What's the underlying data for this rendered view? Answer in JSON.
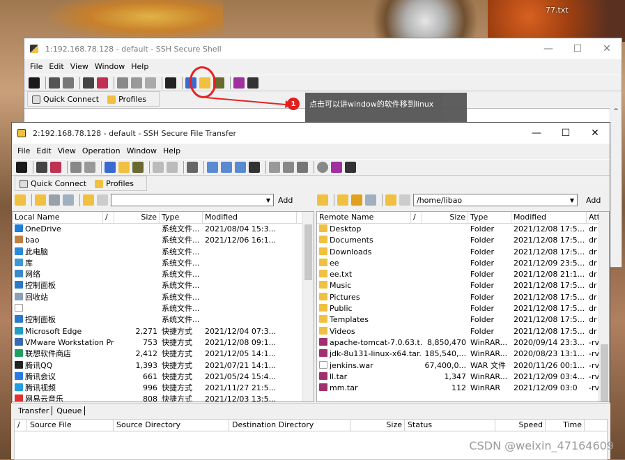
{
  "wallpaper": {
    "file_label": "77.txt"
  },
  "shell_window": {
    "title": "1:192.168.78.128 - default - SSH Secure Shell",
    "menu": [
      "File",
      "Edit",
      "View",
      "Window",
      "Help"
    ],
    "quick_connect": "Quick Connect",
    "profiles": "Profiles"
  },
  "annotation": {
    "badge": "1",
    "text": "点击可以讲window的软件移到linux",
    "color": "#e82020"
  },
  "sftp_window": {
    "title": "2:192.168.78.128 - default - SSH Secure File Transfer",
    "menu": [
      "File",
      "Edit",
      "View",
      "Operation",
      "Window",
      "Help"
    ],
    "quick_connect": "Quick Connect",
    "profiles": "Profiles",
    "local_path": "",
    "remote_path": "/home/libao",
    "add_label": "Add"
  },
  "local": {
    "columns": [
      "Local Name",
      "/",
      "Size",
      "Type",
      "Modified"
    ],
    "rows": [
      {
        "name": "OneDrive",
        "size": "",
        "type": "系统文件...",
        "modified": "2021/08/04 15:3...",
        "icon": "cloud",
        "color": "#1e7fd8"
      },
      {
        "name": "bao",
        "size": "",
        "type": "系统文件...",
        "modified": "2021/12/06 16:1...",
        "icon": "user",
        "color": "#c08040"
      },
      {
        "name": "此电脑",
        "size": "",
        "type": "系统文件...",
        "modified": "",
        "icon": "pc",
        "color": "#2a8ad8"
      },
      {
        "name": "库",
        "size": "",
        "type": "系统文件...",
        "modified": "",
        "icon": "library",
        "color": "#3a9ad8"
      },
      {
        "name": "网络",
        "size": "",
        "type": "系统文件...",
        "modified": "",
        "icon": "network",
        "color": "#3a8ac8"
      },
      {
        "name": "控制面板",
        "size": "",
        "type": "系统文件...",
        "modified": "",
        "icon": "control-panel",
        "color": "#2a7ac8"
      },
      {
        "name": "回收站",
        "size": "",
        "type": "系统文件...",
        "modified": "",
        "icon": "recycle-bin",
        "color": "#8aa0b8"
      },
      {
        "name": "",
        "size": "",
        "type": "系统文件...",
        "modified": "",
        "icon": "blank",
        "color": "#ffffff"
      },
      {
        "name": "控制面板",
        "size": "",
        "type": "系统文件...",
        "modified": "",
        "icon": "control-panel",
        "color": "#2a7ac8"
      },
      {
        "name": "Microsoft Edge",
        "size": "2,271",
        "type": "快捷方式",
        "modified": "2021/12/04 07:3...",
        "icon": "edge",
        "color": "#1ea0c0"
      },
      {
        "name": "VMware Workstation Pro",
        "size": "753",
        "type": "快捷方式",
        "modified": "2021/12/08 09:1...",
        "icon": "vmware",
        "color": "#3a6ab0"
      },
      {
        "name": "联想软件商店",
        "size": "2,412",
        "type": "快捷方式",
        "modified": "2021/12/05 14:1...",
        "icon": "store",
        "color": "#20a060"
      },
      {
        "name": "腾讯QQ",
        "size": "1,393",
        "type": "快捷方式",
        "modified": "2021/07/21 14:1...",
        "icon": "qq",
        "color": "#222222"
      },
      {
        "name": "腾讯会议",
        "size": "661",
        "type": "快捷方式",
        "modified": "2021/05/24 15:4...",
        "icon": "meeting",
        "color": "#2a7ae0"
      },
      {
        "name": "腾讯视频",
        "size": "996",
        "type": "快捷方式",
        "modified": "2021/11/27 21:5...",
        "icon": "video",
        "color": "#20a0e0"
      },
      {
        "name": "网易云音乐",
        "size": "808",
        "type": "快捷方式",
        "modified": "2021/12/03 13:5...",
        "icon": "music",
        "color": "#e03030"
      }
    ]
  },
  "remote": {
    "columns": [
      "Remote Name",
      "/",
      "Size",
      "Type",
      "Modified",
      "Att"
    ],
    "rows": [
      {
        "name": "Desktop",
        "size": "",
        "type": "Folder",
        "modified": "2021/12/08 17:5...",
        "attr": "dr",
        "icon": "folder",
        "color": "#f0c040"
      },
      {
        "name": "Documents",
        "size": "",
        "type": "Folder",
        "modified": "2021/12/08 17:5...",
        "attr": "dr",
        "icon": "folder",
        "color": "#f0c040"
      },
      {
        "name": "Downloads",
        "size": "",
        "type": "Folder",
        "modified": "2021/12/08 17:5...",
        "attr": "dr",
        "icon": "folder",
        "color": "#f0c040"
      },
      {
        "name": "ee",
        "size": "",
        "type": "Folder",
        "modified": "2021/12/09 23:5...",
        "attr": "dr",
        "icon": "folder",
        "color": "#f0c040"
      },
      {
        "name": "ee.txt",
        "size": "",
        "type": "Folder",
        "modified": "2021/12/08 21:1...",
        "attr": "dr",
        "icon": "folder",
        "color": "#f0c040"
      },
      {
        "name": "Music",
        "size": "",
        "type": "Folder",
        "modified": "2021/12/08 17:5...",
        "attr": "dr",
        "icon": "folder",
        "color": "#f0c040"
      },
      {
        "name": "Pictures",
        "size": "",
        "type": "Folder",
        "modified": "2021/12/08 17:5...",
        "attr": "dr",
        "icon": "folder",
        "color": "#f0c040"
      },
      {
        "name": "Public",
        "size": "",
        "type": "Folder",
        "modified": "2021/12/08 17:5...",
        "attr": "dr",
        "icon": "folder",
        "color": "#f0c040"
      },
      {
        "name": "Templates",
        "size": "",
        "type": "Folder",
        "modified": "2021/12/08 17:5...",
        "attr": "dr",
        "icon": "folder",
        "color": "#f0c040"
      },
      {
        "name": "Videos",
        "size": "",
        "type": "Folder",
        "modified": "2021/12/08 17:5...",
        "attr": "dr",
        "icon": "folder",
        "color": "#f0c040"
      },
      {
        "name": "apache-tomcat-7.0.63.t...",
        "size": "8,850,470",
        "type": "WinRAR...",
        "modified": "2020/09/14 23:3...",
        "attr": "-rv",
        "icon": "archive",
        "color": "#a03070"
      },
      {
        "name": "jdk-8u131-linux-x64.tar....",
        "size": "185,540,...",
        "type": "WinRAR...",
        "modified": "2020/08/23 13:1...",
        "attr": "-rv",
        "icon": "archive",
        "color": "#a03070"
      },
      {
        "name": "jenkins.war",
        "size": "67,400,0...",
        "type": "WAR 文件",
        "modified": "2020/11/26 00:1...",
        "attr": "-rv",
        "icon": "file",
        "color": "#ffffff"
      },
      {
        "name": "ll.tar",
        "size": "1,347",
        "type": "WinRAR...",
        "modified": "2021/12/09 03:4...",
        "attr": "-rv",
        "icon": "archive",
        "color": "#a03070"
      },
      {
        "name": "mm.tar",
        "size": "112",
        "type": "WinRAR",
        "modified": "2021/12/09 03:0",
        "attr": "-rv",
        "icon": "archive",
        "color": "#a03070"
      }
    ]
  },
  "transfer": {
    "tabs": [
      "Transfer",
      "Queue"
    ],
    "columns": [
      "/",
      "Source File",
      "Source Directory",
      "Destination Directory",
      "Size",
      "Status",
      "Speed",
      "Time"
    ]
  },
  "watermark": "CSDN @weixin_47164609"
}
